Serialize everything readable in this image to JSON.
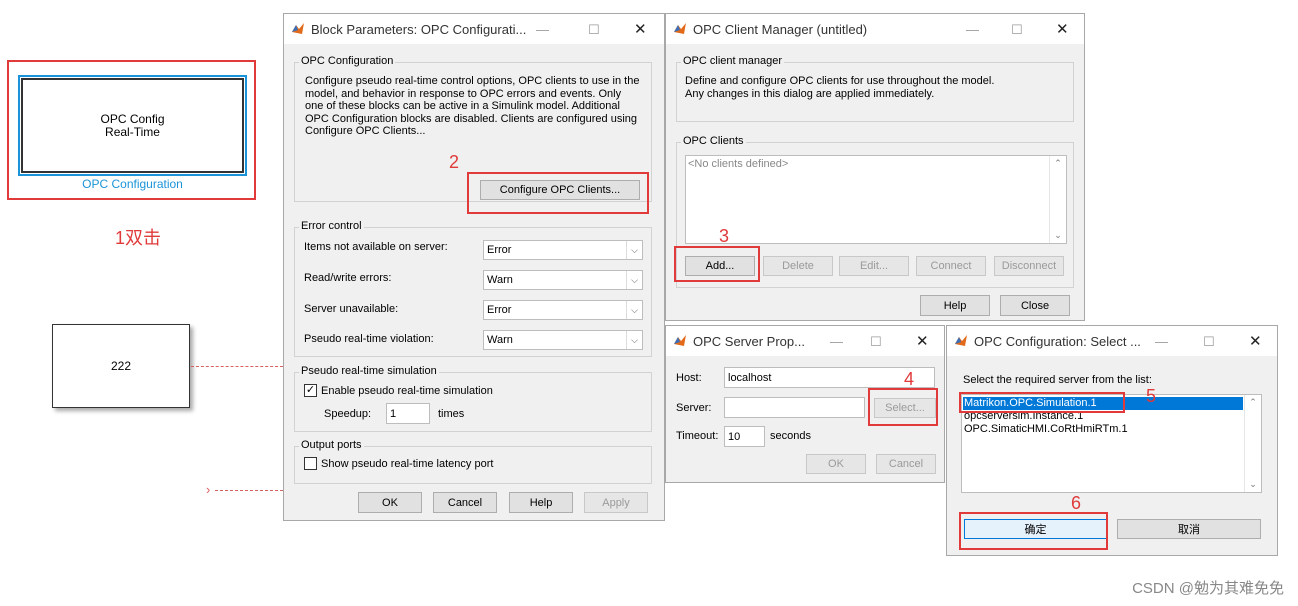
{
  "canvas": {
    "block1_line1": "OPC Config",
    "block1_line2": "Real-Time",
    "block1_caption": "OPC Configuration",
    "annotation_1": "1双击",
    "block2_label": "222",
    "annotation_2": "2",
    "annotation_3": "3",
    "annotation_4": "4",
    "annotation_5": "5",
    "annotation_6": "6"
  },
  "block_params": {
    "title": "Block Parameters: OPC Configurati...",
    "opc_config_group": "OPC Configuration",
    "description": "Configure pseudo real-time control options, OPC clients to use in the model, and behavior in response to OPC errors and events. Only one of these blocks can be active in a Simulink model. Additional OPC Configuration blocks are disabled. Clients are configured using Configure OPC Clients...",
    "configure_button": "Configure OPC Clients...",
    "error_control_group": "Error control",
    "rows": [
      {
        "label": "Items not available on server:",
        "value": "Error"
      },
      {
        "label": "Read/write errors:",
        "value": "Warn"
      },
      {
        "label": "Server unavailable:",
        "value": "Error"
      },
      {
        "label": "Pseudo real-time violation:",
        "value": "Warn"
      }
    ],
    "pseudo_group": "Pseudo real-time simulation",
    "enable_pseudo_label": "Enable pseudo real-time simulation",
    "enable_pseudo_checked": "✓",
    "speedup_label": "Speedup:",
    "speedup_value": "1",
    "speedup_unit": "times",
    "output_ports_group": "Output ports",
    "latency_label": "Show pseudo real-time latency port",
    "ok": "OK",
    "cancel": "Cancel",
    "help": "Help",
    "apply": "Apply"
  },
  "client_manager": {
    "title": "OPC Client Manager (untitled)",
    "manager_group": "OPC client manager",
    "description": "Define and configure OPC clients for use throughout the model. Any changes in this dialog are applied immediately.",
    "clients_group": "OPC Clients",
    "empty_list": "<No clients defined>",
    "add": "Add...",
    "delete": "Delete",
    "edit": "Edit...",
    "connect": "Connect",
    "disconnect": "Disconnect",
    "help": "Help",
    "close": "Close"
  },
  "server_props": {
    "title": "OPC Server Prop...",
    "host_label": "Host:",
    "host_value": "localhost",
    "server_label": "Server:",
    "server_value": "",
    "select_button": "Select...",
    "timeout_label": "Timeout:",
    "timeout_value": "10",
    "timeout_unit": "seconds",
    "ok": "OK",
    "cancel": "Cancel"
  },
  "select_server": {
    "title": "OPC Configuration: Select ...",
    "prompt": "Select the required server from the list:",
    "servers": [
      "Matrikon.OPC.Simulation.1",
      "opcserversim.Instance.1",
      "OPC.SimaticHMI.CoRtHmiRTm.1"
    ],
    "ok": "确定",
    "cancel": "取消"
  },
  "watermark": "CSDN @勉为其难免免",
  "colors": {
    "accent_blue": "#1b93d8",
    "annotation_red": "#e03a3a",
    "selection_blue": "#0078d7"
  }
}
